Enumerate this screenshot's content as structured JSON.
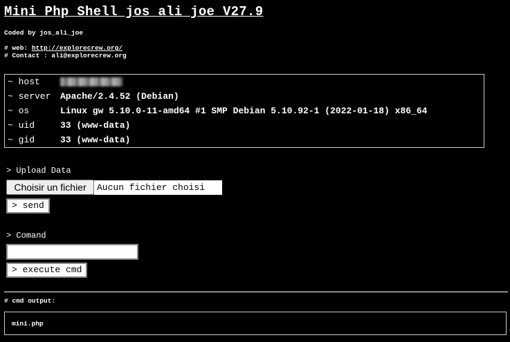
{
  "header": {
    "title": "Mini Php Shell jos_ali_joe V27.9",
    "coded_by": "Coded by jos_ali_joe",
    "web_prefix": "# web: ",
    "web_link": "http://explorecrew.org/",
    "contact": "# Contact : ali@explorecrew.org"
  },
  "info": {
    "rows": [
      {
        "key": "~ host",
        "value": ""
      },
      {
        "key": "~ server",
        "value": "Apache/2.4.52 (Debian)"
      },
      {
        "key": "~ os",
        "value": "Linux gw 5.10.0-11-amd64 #1 SMP Debian 5.10.92-1 (2022-01-18) x86_64"
      },
      {
        "key": "~ uid",
        "value": "33 (www-data)"
      },
      {
        "key": "~ gid",
        "value": "33 (www-data)"
      }
    ]
  },
  "upload": {
    "label": "> Upload Data",
    "choose_file_label": "Choisir un fichier",
    "file_status": "Aucun fichier choisi",
    "send_label": "> send"
  },
  "command": {
    "label": "> Comand",
    "input_value": "",
    "execute_label": "> execute cmd"
  },
  "output": {
    "label": "# cmd output:",
    "text": "mini.php"
  }
}
